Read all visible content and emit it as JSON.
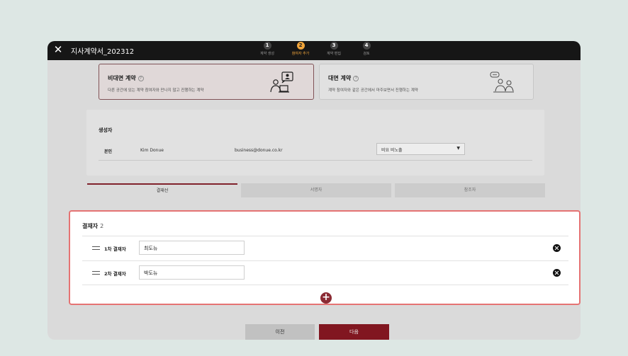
{
  "window": {
    "title": "지사계약서_202312",
    "close_icon": "close-icon"
  },
  "steps": [
    {
      "number": "1",
      "label": "계약 생성"
    },
    {
      "number": "2",
      "label": "참여자 추가"
    },
    {
      "number": "3",
      "label": "계약 편집"
    },
    {
      "number": "4",
      "label": "검토"
    }
  ],
  "contract_types": [
    {
      "title": "비대면 계약",
      "help": "?",
      "description": "다른 공간에 있는 계약 참여자와 만나지 않고 진행하는 계약",
      "icon": "remote-contract-icon"
    },
    {
      "title": "대면 계약",
      "help": "?",
      "description": "계약 참여자와 같은 공간에서 마주보면서 진행하는 계약",
      "icon": "in-person-contract-icon"
    }
  ],
  "creator": {
    "section_title": "생성자",
    "role": "본인",
    "name": "Kim Donue",
    "email": "business@donue.co.kr",
    "select_value": "비요 비노출"
  },
  "tabs": [
    {
      "label": "결재선"
    },
    {
      "label": "서명자"
    },
    {
      "label": "참조자"
    }
  ],
  "approvers": {
    "title": "결재자",
    "count": "2",
    "rows": [
      {
        "label": "1차 결재자",
        "value": "최도뉴"
      },
      {
        "label": "2차 결재자",
        "value": "박도뉴"
      }
    ],
    "add_icon": "plus-icon"
  },
  "footer": {
    "prev_label": "이전",
    "next_label": "다음"
  },
  "colors": {
    "accent": "#8b1823",
    "step_active": "#f0a43a",
    "highlight_border": "#e57373",
    "topbar": "#161616"
  }
}
